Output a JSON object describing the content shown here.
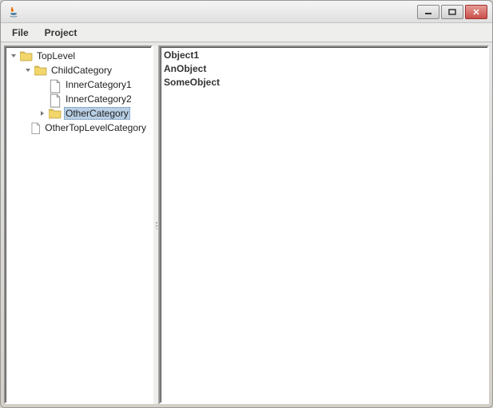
{
  "window": {
    "title": ""
  },
  "menubar": {
    "items": [
      "File",
      "Project"
    ]
  },
  "tree": {
    "nodes": [
      {
        "label": "TopLevel",
        "depth": 0,
        "icon": "folder",
        "toggle": "open",
        "selected": false
      },
      {
        "label": "ChildCategory",
        "depth": 1,
        "icon": "folder",
        "toggle": "open",
        "selected": false
      },
      {
        "label": "InnerCategory1",
        "depth": 2,
        "icon": "leaf",
        "toggle": "none",
        "selected": false
      },
      {
        "label": "InnerCategory2",
        "depth": 2,
        "icon": "leaf",
        "toggle": "none",
        "selected": false
      },
      {
        "label": "OtherCategory",
        "depth": 2,
        "icon": "folder",
        "toggle": "closed",
        "selected": true
      },
      {
        "label": "OtherTopLevelCategory",
        "depth": 1,
        "icon": "leaf",
        "toggle": "none",
        "selected": false
      }
    ]
  },
  "list": {
    "items": [
      "Object1",
      "AnObject",
      "SomeObject"
    ]
  }
}
